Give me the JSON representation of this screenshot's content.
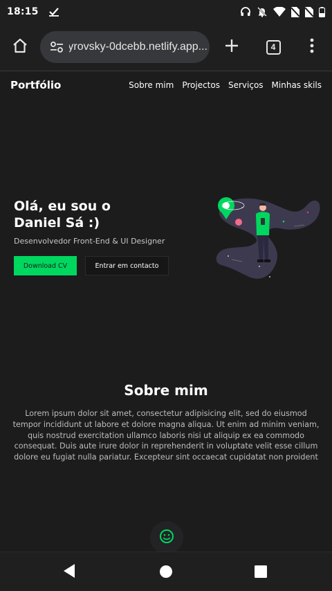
{
  "status_bar": {
    "time": "18:15",
    "icons": [
      "check-icon",
      "headphones-icon",
      "bell-off-icon",
      "wifi-icon",
      "no-sim-icon",
      "no-sim-icon",
      "battery-icon"
    ]
  },
  "browser": {
    "url": "...eyrovsky-0dcebb.netlify.app",
    "tab_count": "4",
    "icons": [
      "home-icon",
      "site-settings-icon",
      "new-tab-icon",
      "tabs-icon",
      "more-vert-icon"
    ]
  },
  "site_nav": {
    "brand": "Portfólio",
    "links": [
      {
        "label": "Sobre mim"
      },
      {
        "label": "Projectos"
      },
      {
        "label": "Serviços"
      },
      {
        "label": "Minhas skils"
      }
    ]
  },
  "hero": {
    "title_line1": "Olá, eu sou o",
    "title_line2": "Daniel Sá :)",
    "subtitle": "Desenvolvedor Front-End & UI Designer",
    "primary_button": "Download CV",
    "secondary_button": "Entrar em contacto"
  },
  "about": {
    "title": "Sobre mim",
    "paragraph": "Lorem ipsum dolor sit amet, consectetur adipisicing elit, sed do eiusmod tempor incididunt ut labore et dolore magna aliqua. Ut enim ad minim veniam, quis nostrud exercitation ullamco laboris nisi ut aliquip ex ea commodo consequat. Duis aute irure dolor in reprehenderit in voluptate velit esse cillum dolore eu fugiat nulla pariatur. Excepteur sint occaecat cupidatat non proident"
  },
  "colors": {
    "accent": "#00d75f",
    "background": "#1c1c1d"
  }
}
